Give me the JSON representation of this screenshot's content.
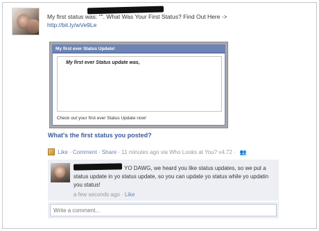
{
  "post": {
    "text": "My first status was: \"\". What Was Your First Status? Find Out Here ->",
    "link": "http://bit.ly/wVe9Le"
  },
  "attachment": {
    "header": "My first ever Status Update!",
    "question": "My first ever Status update was,",
    "footer": "Check out your first ever Status Update now!",
    "title": "What's the first status you posted?"
  },
  "actions": {
    "like": "Like",
    "comment": "Comment",
    "share": "Share",
    "sep": " · ",
    "timestamp": "11 minutes ago via Who Looks at You? v4.72",
    "sep2": " · "
  },
  "comment": {
    "text": "YO DAWG, we heard you like status updates, so we put a status update in yo status update, so you can update yo status while yo updatin you status!",
    "time": "a few seconds ago",
    "like": "Like",
    "sep": " · "
  },
  "composer": {
    "placeholder": "Write a comment..."
  },
  "colors": {
    "link": "#3b5998",
    "action": "#6d84b4",
    "comment_bg": "#edeff4",
    "header_bg": "#6d84b4"
  },
  "icons": {
    "app": "app-icon",
    "people": "people-icon"
  }
}
